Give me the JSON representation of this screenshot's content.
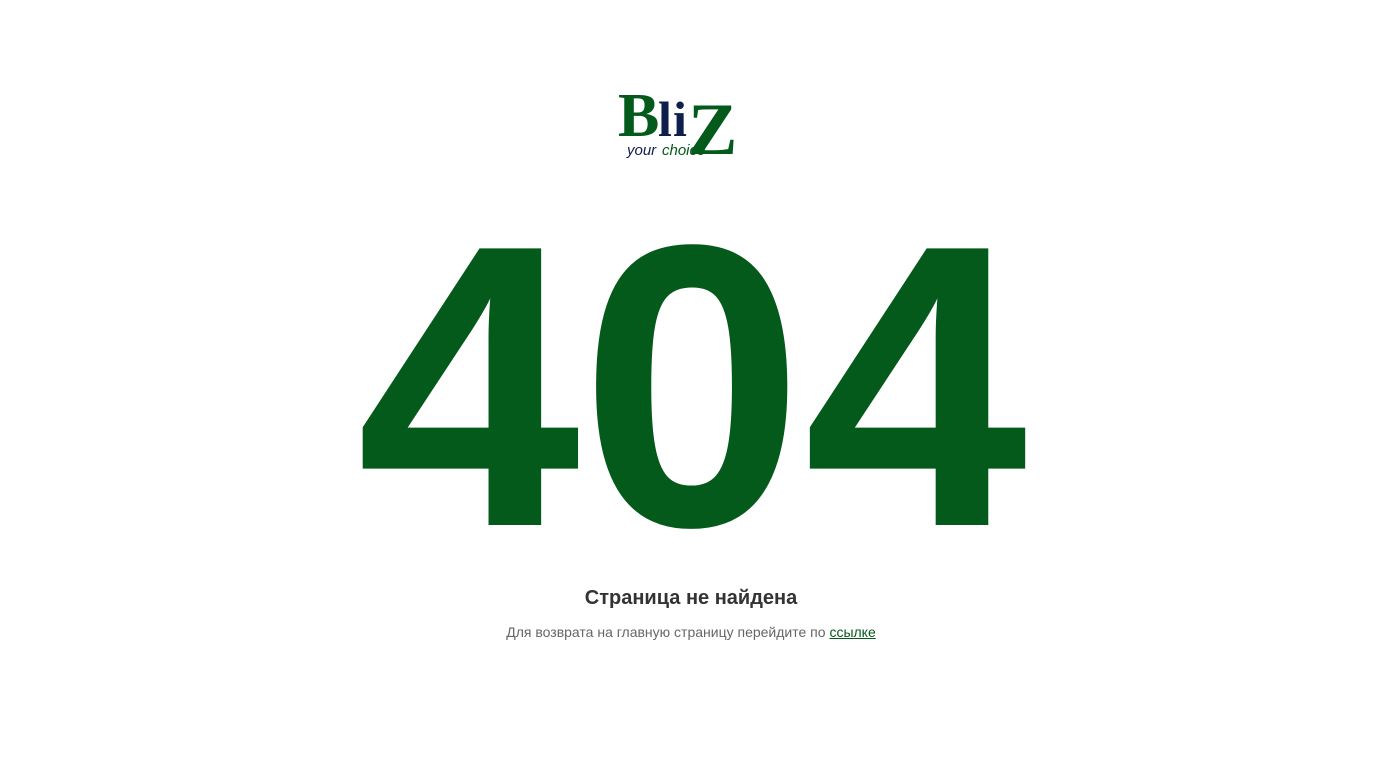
{
  "logo": {
    "name": "Bliz",
    "tagline": "your choice",
    "colors": {
      "green": "#045a1a",
      "navy": "#0f1f4d"
    }
  },
  "error": {
    "code": "404",
    "code_color": "#045a1a",
    "title": "Страница не найдена",
    "description": "Для возврата на главную страницу перейдите по",
    "link_label": "ссылке"
  }
}
